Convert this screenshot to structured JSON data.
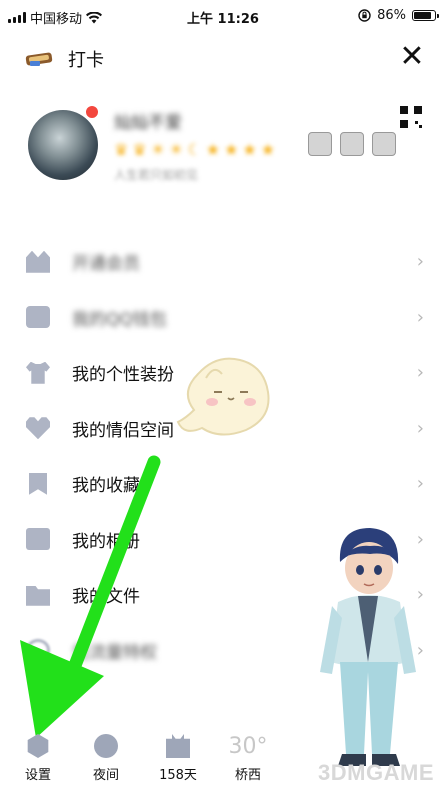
{
  "status_bar": {
    "carrier": "中国移动",
    "time": "上午 11:26",
    "battery_percent": "86%"
  },
  "top_bar": {
    "clock_in_label": "打卡",
    "close_symbol": "✕"
  },
  "profile": {
    "nickname": "灿灿不爱",
    "signature": "人生若只如初见"
  },
  "menu": {
    "items": [
      {
        "label": "开通会员",
        "blurred": true,
        "icon": "shop-icon"
      },
      {
        "label": "我的QQ钱包",
        "blurred": true,
        "icon": "wallet-icon"
      },
      {
        "label": "我的个性装扮",
        "blurred": false,
        "icon": "shirt-icon"
      },
      {
        "label": "我的情侣空间",
        "blurred": false,
        "icon": "heart-icon"
      },
      {
        "label": "我的收藏",
        "blurred": false,
        "icon": "bookmark-icon"
      },
      {
        "label": "我的相册",
        "blurred": false,
        "icon": "photo-icon"
      },
      {
        "label": "我的文件",
        "blurred": false,
        "icon": "folder-icon"
      },
      {
        "label": "免流量特权",
        "blurred": true,
        "icon": "signal-icon"
      }
    ],
    "chevron": "›"
  },
  "bottom_bar": {
    "settings_label": "设置",
    "night_label": "夜间",
    "days_label": "158天",
    "weather_temp": "30°",
    "weather_label": "桥西"
  },
  "watermark": "3DMGAME",
  "colors": {
    "icon_gray": "#aeb4c4",
    "arrow_green": "#22e01a",
    "notification_red": "#f3473e",
    "level_gold": "#f6b11b"
  }
}
